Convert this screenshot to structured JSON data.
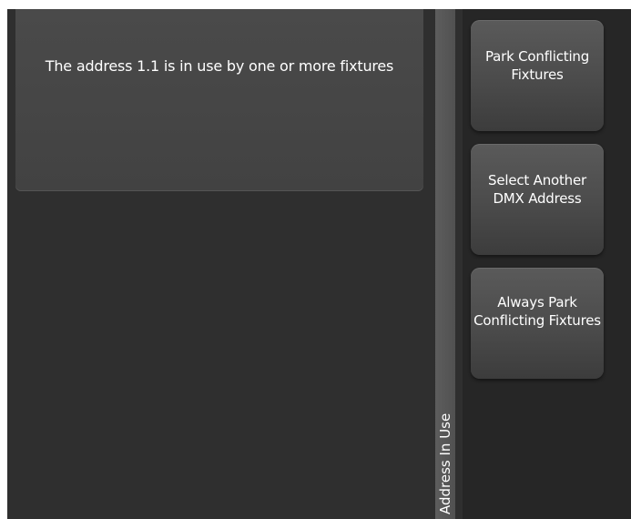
{
  "message": {
    "text": "The address 1.1 is in use by one or more fixtures"
  },
  "sidebar": {
    "title": "Address In Use",
    "buttons": [
      {
        "label": "Park Conflicting Fixtures"
      },
      {
        "label": "Select Another DMX Address"
      },
      {
        "label": "Always Park Conflicting Fixtures"
      }
    ]
  },
  "colors": {
    "background": "#2f2f2f",
    "panel": "#464646",
    "button": "#4b4b4b",
    "text": "#ffffff"
  }
}
